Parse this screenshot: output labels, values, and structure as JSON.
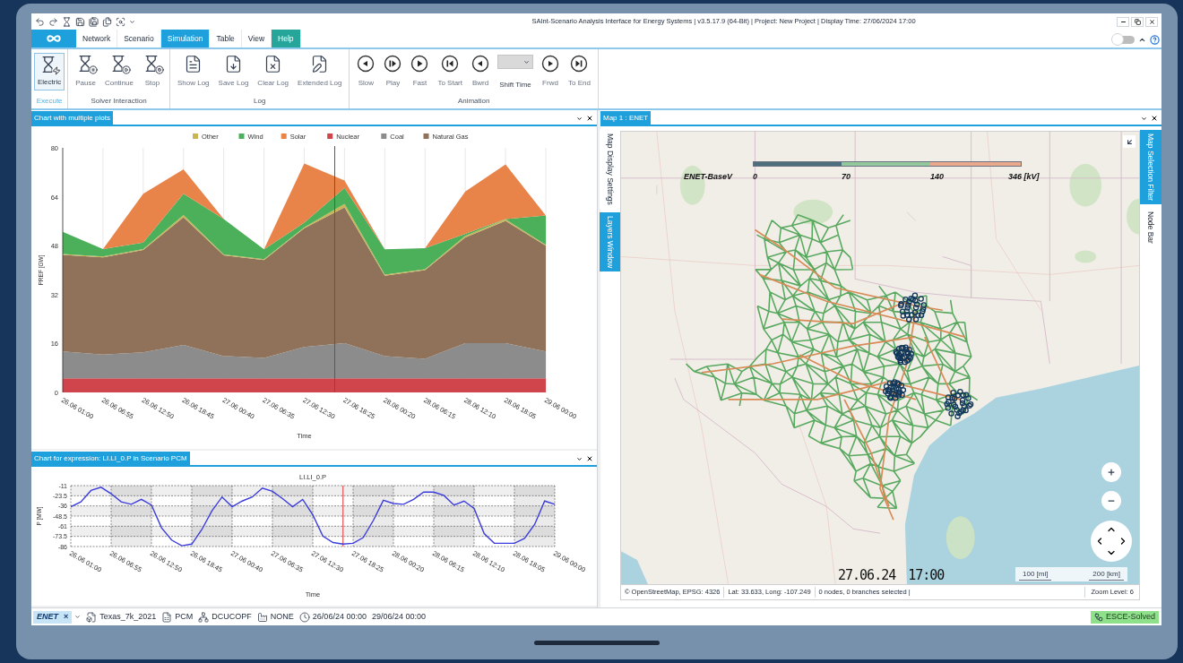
{
  "title_bar": {
    "title": "SAInt-Scenario Analysis Interface for Energy Systems | v3.5.17.9 (64-Bit) | Project: New Project | Display Time: 27/06/2024 17:00"
  },
  "ribbon": {
    "tabs": [
      {
        "label": "Network",
        "selected": false
      },
      {
        "label": "Scenario",
        "selected": false
      },
      {
        "label": "Simulation",
        "selected": true
      },
      {
        "label": "Table",
        "selected": false
      },
      {
        "label": "View",
        "selected": false
      },
      {
        "label": "Help",
        "selected": false,
        "color": "#26a69a"
      }
    ],
    "theme_toggle": {
      "on": false
    },
    "groups": [
      {
        "label": "Execute",
        "active": true,
        "items": [
          {
            "label": "Electric",
            "kind": "toggle",
            "selected": true
          }
        ]
      },
      {
        "label": "Solver Interaction",
        "active": false,
        "items": [
          {
            "label": "Pause",
            "kind": "button"
          },
          {
            "label": "Continue",
            "kind": "button"
          },
          {
            "label": "Stop",
            "kind": "button"
          }
        ]
      },
      {
        "label": "Log",
        "active": false,
        "items": [
          {
            "label": "Show Log",
            "kind": "button"
          },
          {
            "label": "Save Log",
            "kind": "button"
          },
          {
            "label": "Clear Log",
            "kind": "button"
          },
          {
            "label": "Extended Log",
            "kind": "button"
          }
        ]
      },
      {
        "label": "Animation",
        "active": false,
        "items": [
          {
            "label": "Slow",
            "kind": "button"
          },
          {
            "label": "Play",
            "kind": "button"
          },
          {
            "label": "Fast",
            "kind": "button"
          },
          {
            "label": "To Start",
            "kind": "button"
          },
          {
            "label": "Bwrd",
            "kind": "button"
          },
          {
            "label": "Shift Time",
            "kind": "dropdown"
          },
          {
            "label": "Frwd",
            "kind": "button"
          },
          {
            "label": "To End",
            "kind": "button"
          }
        ]
      }
    ]
  },
  "left_panels": [
    {
      "title": "Chart with multiple plots",
      "chart_data": {
        "type": "area",
        "stacked": true,
        "xlabel": "Time",
        "ylabel": "PREF [GW]",
        "ylim": [
          0,
          80
        ],
        "yticks": [
          0,
          16,
          32,
          48,
          64,
          80
        ],
        "categories": [
          "26.06 01:00",
          "26.06 06:55",
          "26.06 12:50",
          "26.06 18:45",
          "27.06 00:40",
          "27.06 06:35",
          "27.06 12:30",
          "27.06 18:25",
          "28.06 00:20",
          "28.06 06:15",
          "28.06 12:10",
          "28.06 18:05",
          "29.06 00:00"
        ],
        "series": [
          {
            "name": "Nuclear",
            "color": "#d0454c",
            "values": [
              4.6,
              4.6,
              4.6,
              4.6,
              4.6,
              4.6,
              4.6,
              4.6,
              4.6,
              4.6,
              4.6,
              4.6,
              4.6
            ]
          },
          {
            "name": "Coal",
            "color": "#8c8c8c",
            "values": [
              8.8,
              7.8,
              8.5,
              10.9,
              7.3,
              6.7,
              10.3,
              11.5,
              7.3,
              6.4,
              11.5,
              11.5,
              8.8
            ]
          },
          {
            "name": "Natural Gas",
            "color": "#8f7259",
            "values": [
              31.6,
              31.8,
              33.5,
              41.8,
              32.9,
              32,
              38.8,
              44.4,
              26.3,
              29,
              34.6,
              40,
              34.6
            ]
          },
          {
            "name": "Other",
            "color": "#c9b458",
            "values": [
              0.3,
              0.3,
              0.3,
              0.7,
              0.3,
              0.3,
              0.3,
              1.2,
              0.3,
              0.3,
              0.5,
              0.5,
              0.3
            ]
          },
          {
            "name": "Wind",
            "color": "#4caf5a",
            "values": [
              7.2,
              2.4,
              2.1,
              7,
              11.6,
              3.2,
              1.5,
              5.2,
              8.3,
              6.9,
              0.7,
              0.1,
              9.6
            ]
          },
          {
            "name": "Solar",
            "color": "#e8834a",
            "values": [
              0,
              0,
              16,
              8,
              0,
              0,
              19.4,
              2.4,
              0,
              0,
              13.8,
              17.9,
              0
            ]
          }
        ],
        "legend": "top",
        "grid": true
      }
    },
    {
      "title": "Chart for expression: LI.LI_0.P in Scenario PCM",
      "chart_data": {
        "type": "line",
        "title": "LI.LI_0.P",
        "xlabel": "Time",
        "ylabel": "P [MW]",
        "ylim": [
          -86,
          -11
        ],
        "yticks": [
          -11,
          {
            "value": -23.5,
            "label": "-23.5"
          },
          -36,
          {
            "value": -48.5,
            "label": "-48.5"
          },
          -61,
          {
            "value": -73.5,
            "label": "-73.5"
          },
          -86
        ],
        "categories": [
          "26.06 01:00",
          null,
          null,
          null,
          "26.06 06:55",
          null,
          null,
          null,
          "26.06 12:50",
          null,
          null,
          null,
          "26.06 18:45",
          null,
          null,
          null,
          "27.06 00:40",
          null,
          null,
          null,
          "27.06 06:35",
          null,
          null,
          null,
          "27.06 12:30",
          null,
          null,
          null,
          "27.06 18:25",
          null,
          null,
          null,
          "28.06 00:20",
          null,
          null,
          null,
          "28.06 06:15",
          null,
          null,
          null,
          "28.06 12:10",
          null,
          null,
          null,
          "28.06 18:05",
          null,
          null,
          null,
          "29.06 00:00"
        ],
        "series": [
          {
            "color": "#3c3cdc",
            "values": [
              -37,
              -31,
              -17,
              -13,
              -21,
              -31,
              -34,
              -28,
              -35,
              -63,
              -78,
              -85,
              -83,
              -65,
              -42,
              -25,
              -37,
              -30,
              -25,
              -14,
              -18,
              -27,
              -37,
              -28,
              -47,
              -73,
              -81,
              -83,
              -82,
              -75,
              -54,
              -29,
              -33,
              -34,
              -28,
              -19,
              -19,
              -23,
              -35,
              -30,
              -39,
              -70,
              -82,
              -82,
              -82,
              -76,
              -59,
              -30,
              -34
            ]
          }
        ],
        "grid": true
      }
    }
  ],
  "map": {
    "title": "Map 1 : ENET",
    "left_tabs": [
      {
        "label": "Map Display Settings",
        "selected": false
      },
      {
        "label": "Layers Window",
        "selected": true
      }
    ],
    "right_tabs": [
      {
        "label": "Map Selection Filter",
        "selected": true
      },
      {
        "label": "Node Bar",
        "selected": false
      }
    ],
    "legend": {
      "title": "ENET-BaseV",
      "ticks": [
        "0",
        "70",
        "140",
        "346 [kV]"
      ]
    },
    "time": {
      "date": "27.06.24",
      "clock": "17:00"
    },
    "scale": [
      "100 [mi]",
      "200 [km]"
    ],
    "footer": {
      "attribution": "© OpenStreetMap,  EPSG: 4326",
      "coords": "Lat: 33.633, Long: -107.249",
      "selection": "0 nodes, 0 branches selected  |",
      "zoom": "Zoom Level: 6"
    }
  },
  "status_bar": {
    "network": "ENET",
    "close": "×",
    "items": [
      {
        "kind": "network-file",
        "text": "Texas_7k_2021"
      },
      {
        "kind": "scenario",
        "text": "PCM"
      },
      {
        "kind": "solver",
        "text": "DCUCOPF"
      },
      {
        "kind": "condition",
        "text": "NONE"
      },
      {
        "kind": "start-time",
        "text": "26/06/24 00:00"
      },
      {
        "kind": "end-time",
        "text": "29/06/24 00:00"
      }
    ],
    "status": "ESCE-Solved"
  }
}
